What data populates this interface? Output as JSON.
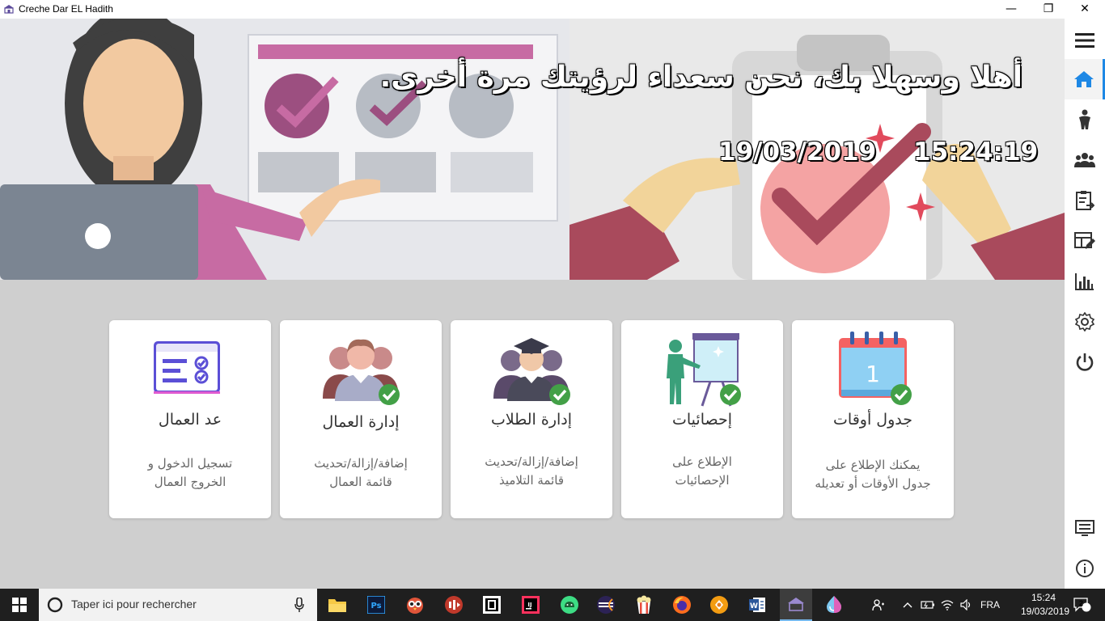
{
  "window": {
    "title": "Creche Dar EL Hadith",
    "minimize_label": "—",
    "maximize_label": "❐",
    "close_label": "✕"
  },
  "banner": {
    "welcome": "أهلا وسهلا بك، نحن سعداء لرؤيتك مرة أخرى.",
    "date": "19/03/2019",
    "time": "15:24:19"
  },
  "sidebar": {
    "items": [
      {
        "icon": "menu-icon",
        "active": false
      },
      {
        "icon": "home-icon",
        "active": true
      },
      {
        "icon": "child-icon",
        "active": false
      },
      {
        "icon": "group-icon",
        "active": false
      },
      {
        "icon": "clipboard-icon",
        "active": false
      },
      {
        "icon": "schedule-edit-icon",
        "active": false
      },
      {
        "icon": "bar-chart-icon",
        "active": false
      },
      {
        "icon": "settings-icon",
        "active": false
      },
      {
        "icon": "power-icon",
        "active": false
      },
      {
        "icon": "display-icon",
        "active": false
      },
      {
        "icon": "info-icon",
        "active": false
      }
    ],
    "accent": "#1e88e5"
  },
  "cards": [
    {
      "icon": "attendance-form-icon",
      "title": "عد العمال",
      "desc_line1": "تسجيل الدخول و",
      "desc_line2": "الخروج العمال"
    },
    {
      "icon": "workers-group-icon",
      "title": "إدارة العمال",
      "desc_line1": "إضافة/إزالة/تحديث",
      "desc_line2": "قائمة العمال"
    },
    {
      "icon": "graduate-group-icon",
      "title": "إدارة الطلاب",
      "desc_line1": "إضافة/إزالة/تحديث",
      "desc_line2": "قائمة التلاميذ"
    },
    {
      "icon": "presentation-board-icon",
      "title": "إحصائيات",
      "desc_line1": "الإطلاع على",
      "desc_line2": "الإحصائيات"
    },
    {
      "icon": "calendar-icon",
      "title": "جدول أوقات",
      "desc_line1": "يمكنك الإطلاع على",
      "desc_line2": "جدول الأوقات أو تعديله",
      "calendar_day": "1"
    }
  ],
  "taskbar": {
    "search_placeholder": "Taper ici pour rechercher",
    "language": "FRA",
    "time": "15:24",
    "date": "19/03/2019",
    "notification_count": "2",
    "apps": [
      "file-explorer-icon",
      "photoshop-icon",
      "owl-app-icon",
      "media-app-icon",
      "jetbrains-toolbox-icon",
      "intellij-icon",
      "android-studio-icon",
      "eclipse-icon",
      "popcorn-icon",
      "firefox-icon",
      "app-orange-icon",
      "word-icon",
      "creche-app-icon",
      "paint-drop-icon"
    ]
  },
  "colors": {
    "background": "#cfcfcf",
    "card": "#ffffff",
    "check_badge": "#43a047",
    "taskbar": "#1f1f1f"
  }
}
